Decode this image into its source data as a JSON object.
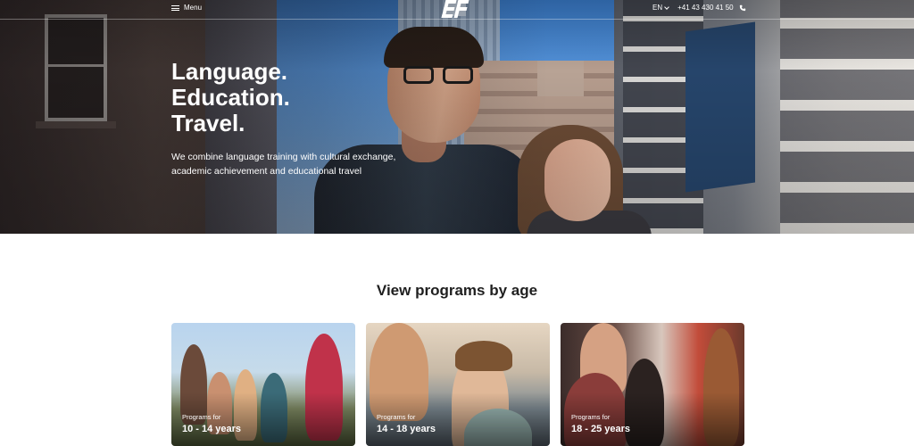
{
  "header": {
    "menu_label": "Menu",
    "language": "EN",
    "phone": "+41 43 430 41 50"
  },
  "hero": {
    "headline": [
      "Language.",
      "Education.",
      "Travel."
    ],
    "subhead": "We combine language training with cultural exchange, academic achievement and educational travel"
  },
  "programs": {
    "title": "View programs by age",
    "cards": [
      {
        "prefix": "Programs for",
        "ages": "10 - 14 years"
      },
      {
        "prefix": "Programs for",
        "ages": "14 - 18 years"
      },
      {
        "prefix": "Programs for",
        "ages": "18 - 25 years"
      }
    ]
  },
  "icons": {
    "menu": "hamburger-icon",
    "language_dropdown": "chevron-down-icon",
    "phone": "phone-icon",
    "logo": "ef-logo"
  }
}
